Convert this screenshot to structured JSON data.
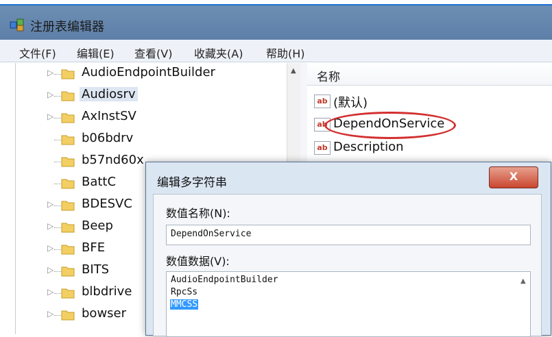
{
  "window": {
    "title": "注册表编辑器"
  },
  "menu": [
    "文件(F)",
    "编辑(E)",
    "查看(V)",
    "收藏夹(A)",
    "帮助(H)"
  ],
  "tree": {
    "items": [
      {
        "label": "AudioEndpointBuilder",
        "expandable": true
      },
      {
        "label": "Audiosrv",
        "expandable": true,
        "selected": true
      },
      {
        "label": "AxInstSV",
        "expandable": true
      },
      {
        "label": "b06bdrv",
        "expandable": false
      },
      {
        "label": "b57nd60x",
        "expandable": false
      },
      {
        "label": "BattC",
        "expandable": false
      },
      {
        "label": "BDESVC",
        "expandable": true
      },
      {
        "label": "Beep",
        "expandable": true
      },
      {
        "label": "BFE",
        "expandable": true
      },
      {
        "label": "BITS",
        "expandable": true
      },
      {
        "label": "blbdrive",
        "expandable": true
      },
      {
        "label": "bowser",
        "expandable": true
      }
    ]
  },
  "values": {
    "column_header": "名称",
    "items": [
      {
        "name": "(默认)",
        "icon": "string-value-icon"
      },
      {
        "name": "DependOnService",
        "icon": "string-value-icon",
        "circled": true
      },
      {
        "name": "Description",
        "icon": "string-value-icon"
      }
    ]
  },
  "dialog": {
    "title": "编辑多字符串",
    "close_label": "X",
    "name_label": "数值名称(N):",
    "name_value": "DependOnService",
    "data_label": "数值数据(V):",
    "data_lines": [
      "AudioEndpointBuilder",
      "RpcSs",
      "MMCSS"
    ],
    "selected_line": "MMCSS"
  },
  "colors": {
    "accent": "#1b6fd6",
    "annotation": "#d32f2f",
    "selection": "#3399ff"
  }
}
